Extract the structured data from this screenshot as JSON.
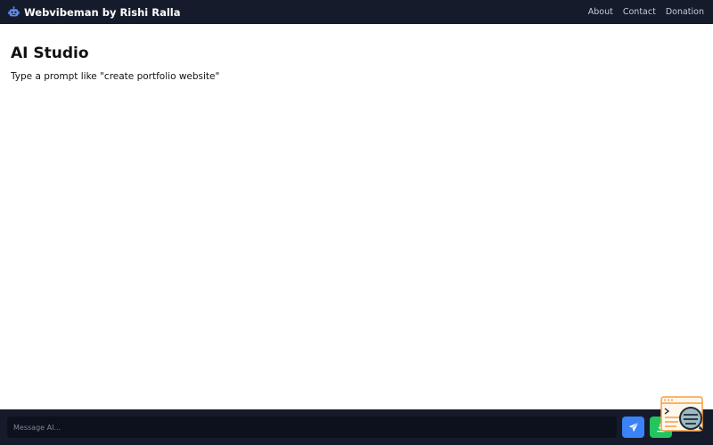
{
  "navbar": {
    "brand_icon": "robot-icon",
    "brand_title": "Webvibeman by Rishi Ralla",
    "links": [
      {
        "label": "About"
      },
      {
        "label": "Contact"
      },
      {
        "label": "Donation"
      }
    ]
  },
  "main": {
    "title": "AI Studio",
    "subtitle": "Type a prompt like \"create portfolio website\""
  },
  "chat": {
    "placeholder": "Message AI...",
    "value": "",
    "send_icon": "paper-plane-icon",
    "download_icon": "download-icon"
  },
  "widget": {
    "icon": "terminal-chat-icon"
  },
  "colors": {
    "navbar_bg": "#161b2b",
    "send_button": "#3b82f6",
    "download_button": "#22c55e",
    "widget_accent": "#f59e42"
  }
}
